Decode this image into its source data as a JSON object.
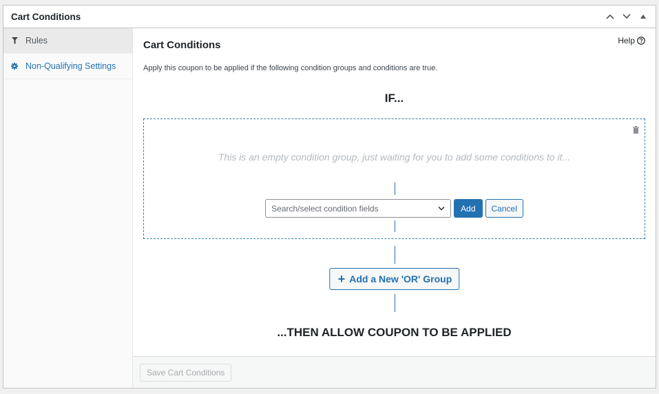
{
  "postbox": {
    "title": "Cart Conditions",
    "actions": [
      "move-up",
      "move-down",
      "toggle-panel"
    ]
  },
  "sidebar": {
    "items": [
      {
        "label": "Rules",
        "icon": "filter-icon",
        "active": true
      },
      {
        "label": "Non-Qualifying Settings",
        "icon": "gear-icon",
        "active": false
      }
    ]
  },
  "main": {
    "help_label": "Help",
    "title": "Cart Conditions",
    "description": "Apply this coupon to be applied if the following condition groups and conditions are true.",
    "if_label": "IF...",
    "group": {
      "empty_message": "This is an empty condition group, just waiting for you to add some conditions to it...",
      "select_placeholder": "Search/select condition fields",
      "add_label": "Add",
      "cancel_label": "Cancel"
    },
    "or_group_label": "Add a New 'OR' Group",
    "then_label": "...THEN ALLOW COUPON TO BE APPLIED"
  },
  "footer": {
    "save_label": "Save Cart Conditions"
  },
  "colors": {
    "accent": "#2271b1",
    "group_border": "#2e7fa8",
    "sidebar_active_bg": "#eaeaea"
  }
}
